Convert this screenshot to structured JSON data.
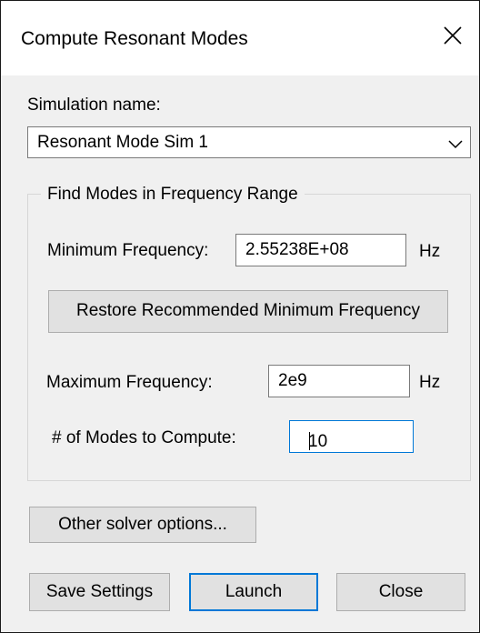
{
  "window": {
    "title": "Compute Resonant Modes",
    "close_icon": "close-icon"
  },
  "simulation": {
    "label": "Simulation name:",
    "selected": "Resonant Mode Sim 1"
  },
  "frequency_group": {
    "title": "Find Modes in Frequency Range",
    "min_label": "Minimum Frequency:",
    "min_value": "2.55238E+08",
    "min_unit": "Hz",
    "restore_button": "Restore Recommended Minimum Frequency",
    "max_label": "Maximum Frequency:",
    "max_value": "2e9",
    "max_unit": "Hz",
    "modes_label": "# of Modes to Compute:",
    "modes_value": "10"
  },
  "buttons": {
    "other_options": "Other solver options...",
    "save": "Save Settings",
    "launch": "Launch",
    "close": "Close"
  },
  "colors": {
    "accent": "#0078d7",
    "button_bg": "#e1e1e1",
    "window_bg": "#f0f0f0"
  }
}
